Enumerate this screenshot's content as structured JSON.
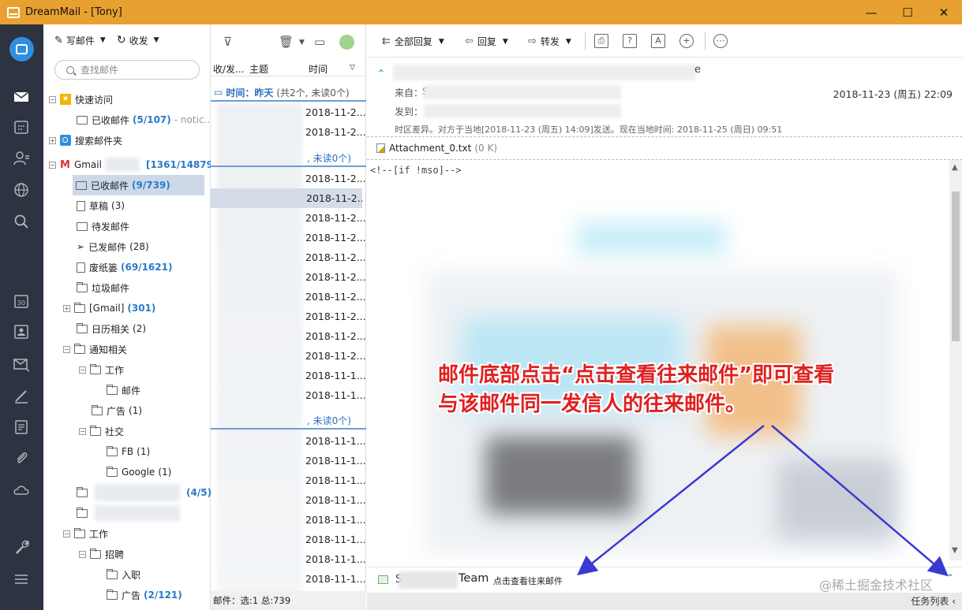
{
  "window": {
    "title": "DreamMail - [Tony]",
    "min": "—",
    "max": "☐",
    "close": "✕"
  },
  "folders_toolbar": {
    "compose": "写邮件",
    "receive": "收发"
  },
  "search": {
    "placeholder": "查找邮件"
  },
  "tree": {
    "quick_access": "快速访问",
    "quick_inbox": "已收邮件",
    "quick_inbox_count": "(5/107)",
    "quick_inbox_note": "- notic...",
    "search_folders": "搜索邮件夹",
    "gmail": "Gmail",
    "gmail_count": "[1361/14879]",
    "inbox": "已收邮件",
    "inbox_count": "(9/739)",
    "drafts": "草稿",
    "drafts_count": "(3)",
    "outbox": "待发邮件",
    "sent": "已发邮件",
    "sent_count": "(28)",
    "trash": "废纸篓",
    "trash_count": "(69/1621)",
    "junk": "垃圾邮件",
    "gmail_folder": "[Gmail]",
    "gmail_folder_count": "(301)",
    "calendar": "日历相关",
    "calendar_count": "(2)",
    "notify": "通知相关",
    "work": "工作",
    "mail": "邮件",
    "ads": "广告",
    "ads_count": "(1)",
    "social": "社交",
    "fb": "FB",
    "fb_count": "(1)",
    "google": "Google",
    "google_count": "(1)",
    "blurred_count": "(4/5)",
    "work2": "工作",
    "recruit": "招聘",
    "onboard": "入职",
    "ads2": "广告",
    "ads2_count": "(2/121)"
  },
  "list": {
    "col_from": "收/发...",
    "col_subject": "主题",
    "col_time": "时间",
    "group1_label": "时间：昨天",
    "group1_sub": "(共2个, 未读0个)",
    "group2_sub": ", 未读0个)",
    "group3_sub": ", 未读0个)",
    "rows": [
      "2018-11-2...",
      "2018-11-2...",
      "2018-11-2...",
      "2018-11-2...",
      "2018-11-2...",
      "2018-11-2...",
      "2018-11-2...",
      "2018-11-2...",
      "2018-11-2...",
      "2018-11-2...",
      "2018-11-2...",
      "2018-11-2...",
      "2018-11-1...",
      "2018-11-1...",
      "2018-11-1...",
      "2018-11-1...",
      "2018-11-1...",
      "2018-11-1...",
      "2018-11-1...",
      "2018-11-1...",
      "2018-11-1...",
      "2018-11-1...",
      "2018-11-1..."
    ],
    "status": "邮件：选:1 总:739"
  },
  "reader": {
    "reply_all": "全部回复",
    "reply": "回复",
    "forward": "转发",
    "subject_tail": "e",
    "from_label": "来自：",
    "from_initial": "S",
    "to_label": "发到：",
    "date": "2018-11-23 (周五) 22:09",
    "tz_note": "时区差异。对方于当地[2018-11-23 (周五) 14:09]发送。现在当地时间: 2018-11-25 (周日) 09:51",
    "attachment": "Attachment_0.txt",
    "attachment_size": "(0 K)",
    "body_code": "<!--[if !mso]-->",
    "bottom_prefix": "S",
    "bottom_team": "Team",
    "bottom_link": "点击查看往来邮件",
    "taskbar": "任务列表",
    "watermark": "@稀土掘金技术社区"
  },
  "annotation": {
    "line1": "邮件底部点击“点击查看往来邮件”即可查看",
    "line2": "与该邮件同一发信人的往来邮件。",
    "color": "#e02020",
    "arrow_color": "#3a3ad0"
  },
  "colors": {
    "titlebar": "#e8a030",
    "rail": "#2d3340",
    "accent": "#2e8fe0",
    "count_blue": "#2a7ac8"
  }
}
